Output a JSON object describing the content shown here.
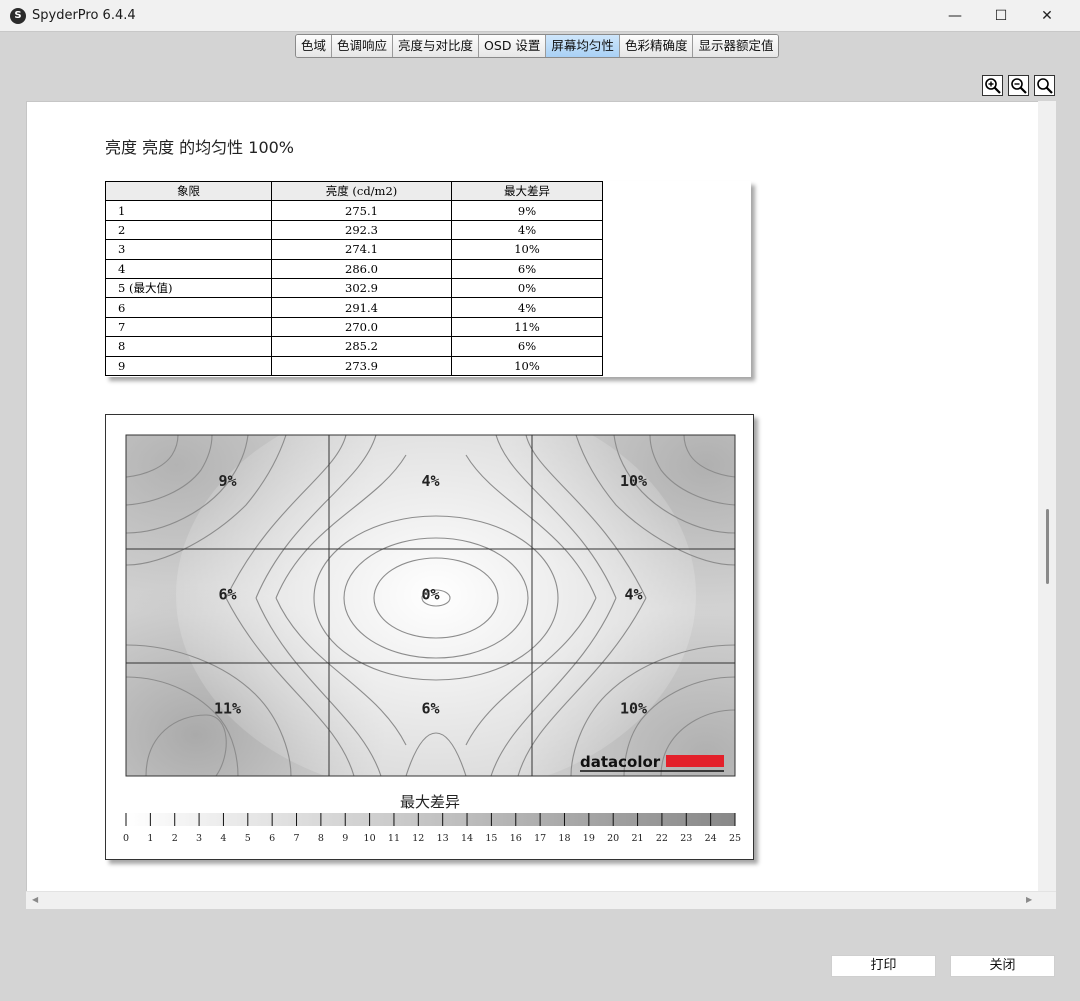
{
  "window": {
    "app_icon": "S",
    "title": "SpyderPro 6.4.4",
    "minimize": "—",
    "maximize": "☐",
    "close": "✕"
  },
  "tabs": [
    {
      "label": "色域",
      "active": false
    },
    {
      "label": "色调响应",
      "active": false
    },
    {
      "label": "亮度与对比度",
      "active": false
    },
    {
      "label": "OSD 设置",
      "active": false
    },
    {
      "label": "屏幕均匀性",
      "active": true
    },
    {
      "label": "色彩精确度",
      "active": false
    },
    {
      "label": "显示器额定值",
      "active": false
    }
  ],
  "zoom_icons": [
    "zoom-in-icon",
    "zoom-out-icon",
    "zoom-fit-icon"
  ],
  "report": {
    "title": "亮度 亮度 的均匀性 100%",
    "table": {
      "headers": [
        "象限",
        "亮度 (cd/m2)",
        "最大差异"
      ],
      "rows": [
        [
          "1",
          "275.1",
          "9%"
        ],
        [
          "2",
          "292.3",
          "4%"
        ],
        [
          "3",
          "274.1",
          "10%"
        ],
        [
          "4",
          "286.0",
          "6%"
        ],
        [
          "5 (最大值)",
          "302.9",
          "0%"
        ],
        [
          "6",
          "291.4",
          "4%"
        ],
        [
          "7",
          "270.0",
          "11%"
        ],
        [
          "8",
          "285.2",
          "6%"
        ],
        [
          "9",
          "273.9",
          "10%"
        ]
      ]
    }
  },
  "chart_data": {
    "type": "heatmap",
    "grid": [
      3,
      3
    ],
    "cell_labels": [
      "9%",
      "4%",
      "10%",
      "6%",
      "0%",
      "4%",
      "11%",
      "6%",
      "10%"
    ],
    "cell_values": [
      9,
      4,
      10,
      6,
      0,
      4,
      11,
      6,
      10
    ],
    "logo": "datacolor",
    "scale_title": "最大差异",
    "scale_ticks": [
      "0",
      "1",
      "2",
      "3",
      "4",
      "5",
      "6",
      "7",
      "8",
      "9",
      "10",
      "11",
      "12",
      "13",
      "14",
      "15",
      "16",
      "17",
      "18",
      "19",
      "20",
      "21",
      "22",
      "23",
      "24",
      "25"
    ],
    "scale_range": [
      0,
      25
    ],
    "colors": {
      "low": "#ffffff",
      "high": "#888888",
      "contour": "#8c8c8c",
      "logo_bar": "#e3202a"
    }
  },
  "buttons": {
    "print": "打印",
    "close": "关闭"
  }
}
